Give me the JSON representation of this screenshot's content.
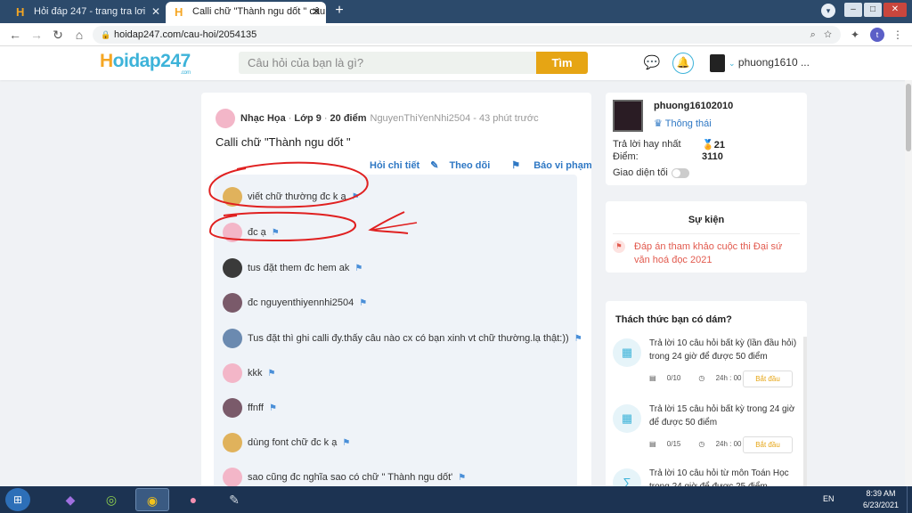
{
  "browser": {
    "tabs": [
      {
        "label": "Hỏi đáp 247 - trang tra lơi",
        "active": false
      },
      {
        "label": "Calli chữ \"Thành ngu dốt \" câu hỏi",
        "active": true
      }
    ],
    "url": "hoidap247.com/cau-hoi/2054135",
    "profile_initial": "t"
  },
  "site": {
    "logo_h": "H",
    "logo_rest": "oidap247",
    "logo_com": ".com",
    "search_placeholder": "Câu hỏi của bạn là gì?",
    "search_button": "Tìm",
    "username_short": "phuong1610 ..."
  },
  "question": {
    "subject": "Nhạc Họa",
    "grade": "Lớp 9",
    "points": "20 điểm",
    "author": "NguyenThiYenNhi2504 - 43 phút trước",
    "title": "Calli chữ \"Thành ngu dốt \"",
    "actions": {
      "detail": "Hỏi chi tiết",
      "follow": "Theo dõi",
      "report": "Báo vi phạm"
    }
  },
  "comments": [
    {
      "text": "viết chữ thường đc k ạ",
      "avatar_color": "#e0b25c"
    },
    {
      "text": "đc ạ",
      "avatar_color": "#f3b6c8"
    },
    {
      "text": "tus đặt them đc hem ak",
      "avatar_color": "#3a3a3a"
    },
    {
      "text": "đc nguyenthiyennhi2504",
      "avatar_color": "#7a5a6a"
    },
    {
      "text": "Tus đặt thì ghi calli đy.thấy câu nào cx có bạn xinh vt chữ thường.lạ thật:))",
      "avatar_color": "#6b8ab0"
    },
    {
      "text": "kkk",
      "avatar_color": "#f3b6c8"
    },
    {
      "text": "ffnff",
      "avatar_color": "#7a5a6a"
    },
    {
      "text": "dùng font chữ đc k ạ",
      "avatar_color": "#e0b25c"
    },
    {
      "text": "sao cũng đc nghĩa sao có chữ \" Thành ngu dốt'",
      "avatar_color": "#f3b6c8"
    }
  ],
  "user_card": {
    "name": "phuong16102010",
    "status": "Thông thái",
    "best_label": "Trả lời hay nhất",
    "best_value": "21",
    "points_label": "Điểm:",
    "points_value": "3110",
    "theme_label": "Giao diện tối"
  },
  "event_card": {
    "title": "Sự kiện",
    "text": "Đáp án tham khảo cuộc thi Đại sứ văn hoá đọc 2021"
  },
  "challenge_card": {
    "title": "Thách thức bạn có dám?",
    "items": [
      {
        "text": "Trả lời 10 câu hỏi  bất kỳ (lần đầu hỏi) trong 24 giờ để được 50 điểm",
        "progress": "0/10",
        "time": "24h : 00",
        "button": "Bắt đầu"
      },
      {
        "text": "Trả lời 15 câu hỏi  bất kỳ  trong 24 giờ để được 50 điểm",
        "progress": "0/15",
        "time": "24h : 00",
        "button": "Bắt đầu"
      },
      {
        "text": "Trả lời 10 câu hỏi  từ môn Toán Học trong 24 giờ để được 25 điểm",
        "progress": "",
        "time": "",
        "button": ""
      }
    ]
  },
  "taskbar": {
    "lang": "EN",
    "time": "8:39 AM",
    "date": "6/23/2021"
  },
  "colors": {
    "brand_blue": "#3db3d9",
    "brand_orange": "#e6a514",
    "link_blue": "#2f78c4",
    "annotation_red": "#e02020"
  }
}
